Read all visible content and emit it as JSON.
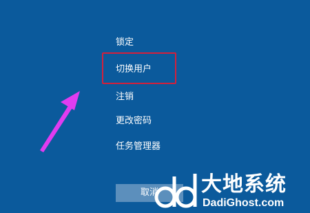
{
  "menu": {
    "lock": "锁定",
    "switch_user": "切换用户",
    "sign_out": "注销",
    "change_password": "更改密码",
    "task_manager": "任务管理器"
  },
  "cancel_button": {
    "label": "取消"
  },
  "watermark": {
    "title": "大地系统",
    "url": "DadiGhost.com"
  },
  "colors": {
    "background": "#0b5a9c",
    "highlight_border": "#d61f3a",
    "arrow": "#e03cf0",
    "cancel_button_bg": "#5c8fbc"
  },
  "icons": {
    "annotation_arrow": "arrow-icon",
    "watermark_logo": "dd-logo-icon"
  }
}
